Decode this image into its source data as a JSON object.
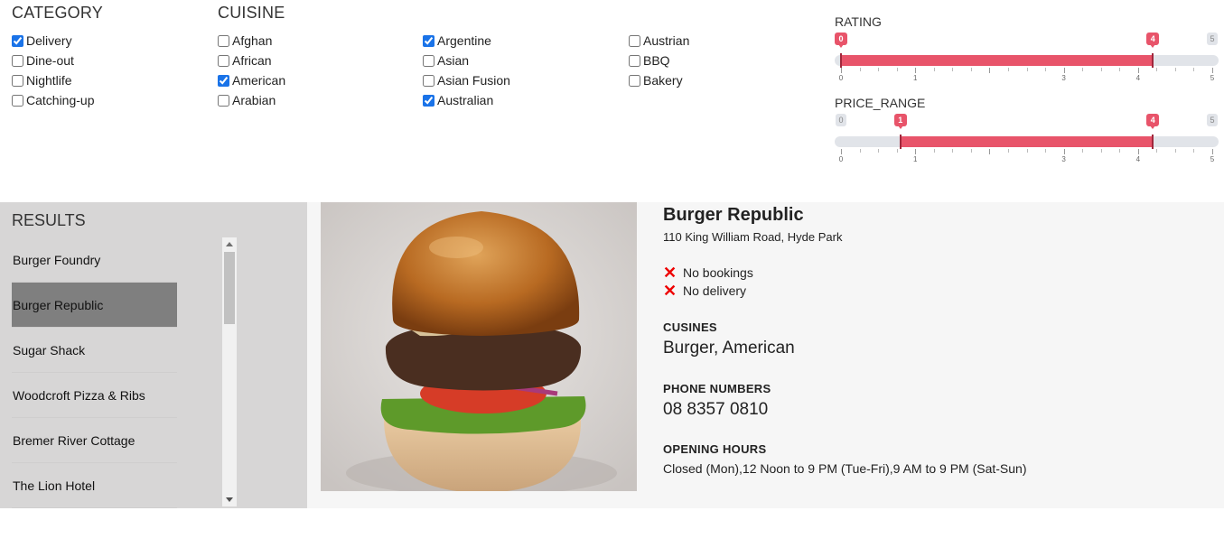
{
  "category": {
    "title": "CATEGORY",
    "options": [
      {
        "label": "Delivery",
        "checked": true
      },
      {
        "label": "Dine-out",
        "checked": false
      },
      {
        "label": "Nightlife",
        "checked": false
      },
      {
        "label": "Catching-up",
        "checked": false
      }
    ]
  },
  "cuisine": {
    "title": "CUISINE",
    "columns": [
      [
        {
          "label": "Afghan",
          "checked": false
        },
        {
          "label": "African",
          "checked": false
        },
        {
          "label": "American",
          "checked": true
        },
        {
          "label": "Arabian",
          "checked": false
        }
      ],
      [
        {
          "label": "Argentine",
          "checked": true
        },
        {
          "label": "Asian",
          "checked": false
        },
        {
          "label": "Asian Fusion",
          "checked": false
        },
        {
          "label": "Australian",
          "checked": true
        }
      ],
      [
        {
          "label": "Austrian",
          "checked": false
        },
        {
          "label": "BBQ",
          "checked": false
        },
        {
          "label": "Bakery",
          "checked": false
        }
      ]
    ]
  },
  "rating": {
    "label": "RATING",
    "min": 0,
    "max": 5,
    "low": 0,
    "high": 4.2,
    "low_label": "0",
    "high_label": "4",
    "end_label": "5",
    "tick_labels": [
      "0",
      "1",
      "3",
      "4",
      "5"
    ],
    "tick_values": [
      0,
      1,
      3,
      4,
      5
    ]
  },
  "price_range": {
    "label": "PRICE_RANGE",
    "min": 0,
    "max": 5,
    "low": 0.8,
    "high": 4.2,
    "start_label": "0",
    "low_label": "1",
    "high_label": "4",
    "end_label": "5",
    "tick_labels": [
      "0",
      "1",
      "3",
      "4",
      "5"
    ],
    "tick_values": [
      0,
      1,
      3,
      4,
      5
    ]
  },
  "results": {
    "title": "RESULTS",
    "items": [
      "Burger Foundry",
      "Burger Republic",
      "Sugar Shack",
      "Woodcroft Pizza & Ribs",
      "Bremer River Cottage",
      "The Lion Hotel"
    ],
    "selected": "Burger Republic"
  },
  "detail": {
    "name": "Burger Republic",
    "address": "110 King William Road, Hyde Park",
    "flags": [
      "No bookings",
      "No delivery"
    ],
    "cuisines_heading": "CUSINES",
    "cuisines": "Burger, American",
    "phone_heading": "PHONE NUMBERS",
    "phone": "08 8357 0810",
    "hours_heading": "OPENING HOURS",
    "hours": "Closed (Mon),12 Noon to 9 PM (Tue-Fri),9 AM to 9 PM (Sat-Sun)"
  },
  "colors": {
    "accent": "#e8546a",
    "track": "#e1e4e9",
    "x_mark": "#ee0000",
    "selected_row": "#7f7f7f"
  }
}
